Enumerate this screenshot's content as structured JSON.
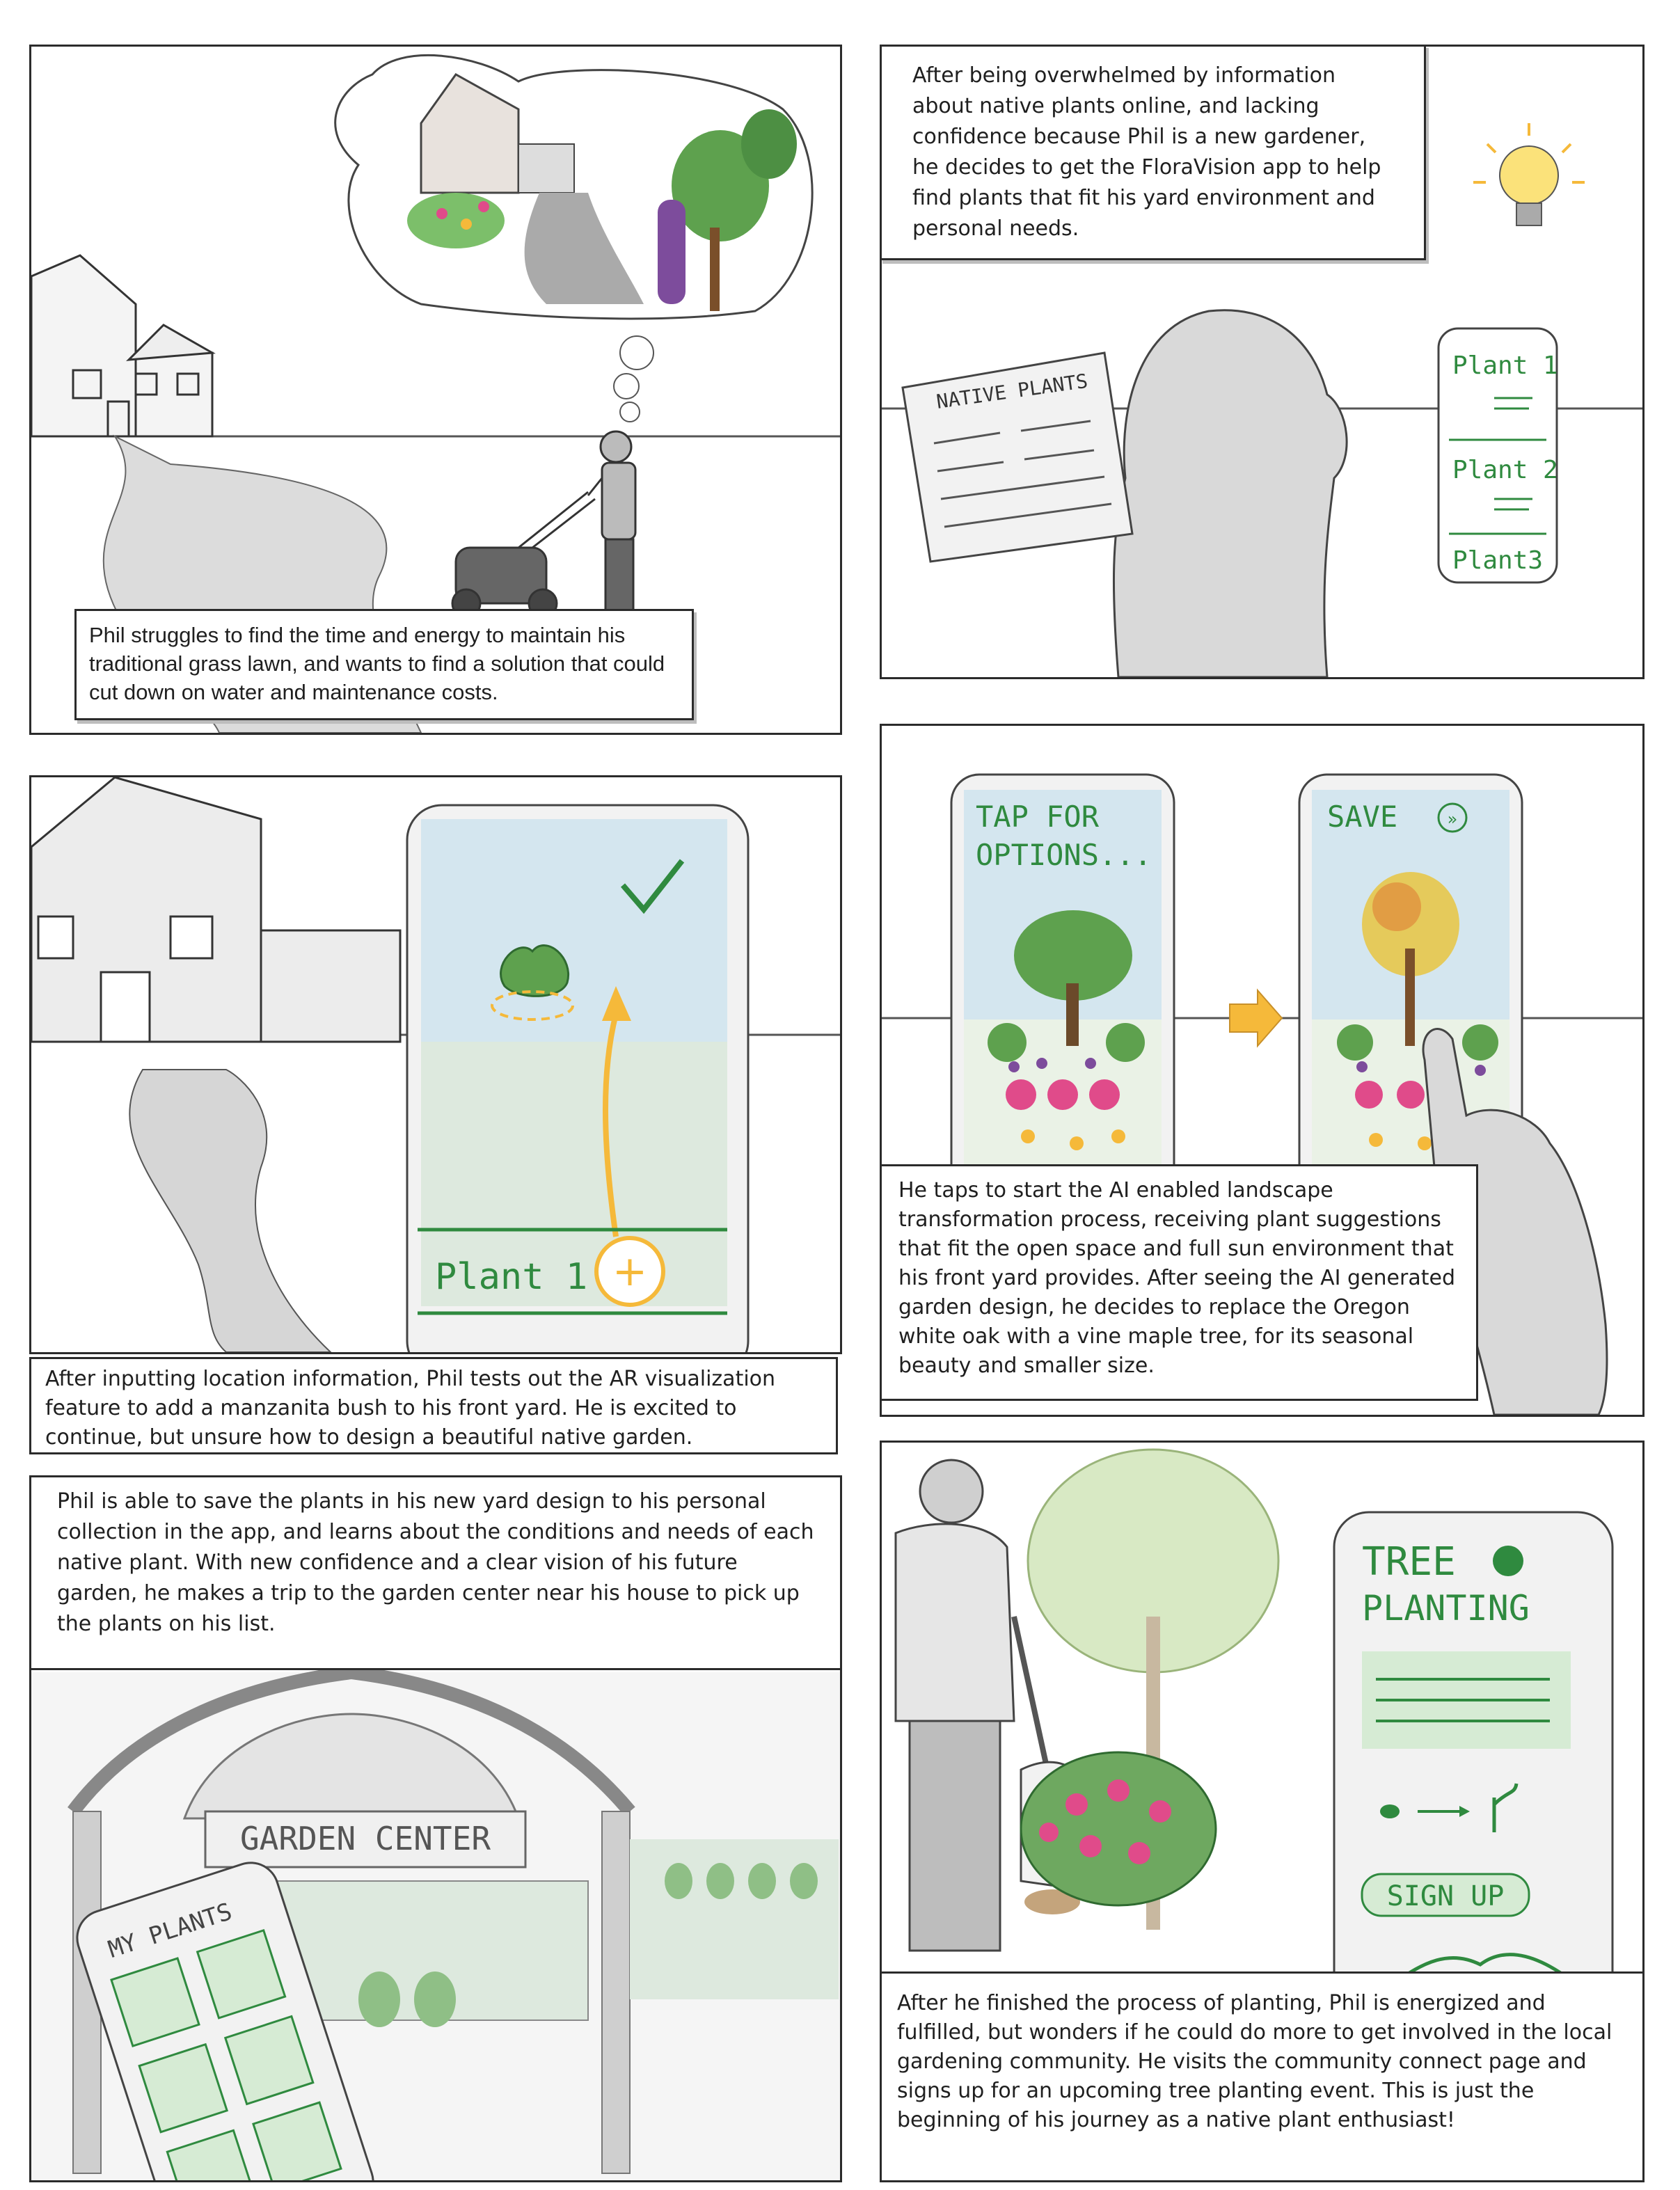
{
  "panels": {
    "p1": {
      "caption": "Phil struggles to find the time and energy to maintain his traditional grass lawn, and wants to find a solution that could cut down on water and maintenance costs."
    },
    "p2": {
      "caption": "After being overwhelmed by information about native plants online, and lacking confidence because Phil is a new gardener, he decides to get the FloraVision app to help find plants that fit his yard environment and personal needs.",
      "paper_title": "NATIVE PLANTS",
      "phone_items": [
        "Plant 1",
        "Plant 2",
        "Plant3"
      ]
    },
    "p3": {
      "caption": "After inputting location information, Phil tests out the AR visualization feature to add a manzanita bush to his front yard. He is excited to continue, but unsure how to design a beautiful native garden.",
      "list_item": "Plant 1"
    },
    "p4": {
      "caption": "He taps to start the AI enabled landscape transformation process, receiving plant suggestions that fit the open space and full sun environment that his front yard provides. After seeing the AI generated garden design, he decides to replace the Oregon white oak with a vine maple tree, for its seasonal beauty and smaller size.",
      "phone1_text_line1": "TAP FOR",
      "phone1_text_line2": "OPTIONS...",
      "phone2_text": "SAVE"
    },
    "p5": {
      "caption": "Phil is able to save the plants in his new yard design to his personal collection in the app, and learns about the conditions and needs of each native plant. With new confidence and a clear vision of his future garden, he makes a trip to the garden center near his house to pick up the plants on his list.",
      "sign": "GARDEN CENTER",
      "phone_title": "MY PLANTS"
    },
    "p6": {
      "caption": "After he finished the process of planting, Phil is energized and fulfilled, but wonders if he could do more to get involved in the local gardening community. He visits the community connect page and signs up for an upcoming tree planting event. This is just the beginning of his journey as a native plant enthusiast!",
      "phone_title_line1": "TREE",
      "phone_title_line2": "PLANTING",
      "signup": "SIGN UP"
    }
  },
  "colors": {
    "ink": "#2b2b2b",
    "sketch_gray": "#cfcfcf",
    "plant_green": "#2f8a3f",
    "sky_blue": "#d4e6ef",
    "accent_yellow": "#f5b93a",
    "flower_pink": "#e04b8a"
  }
}
